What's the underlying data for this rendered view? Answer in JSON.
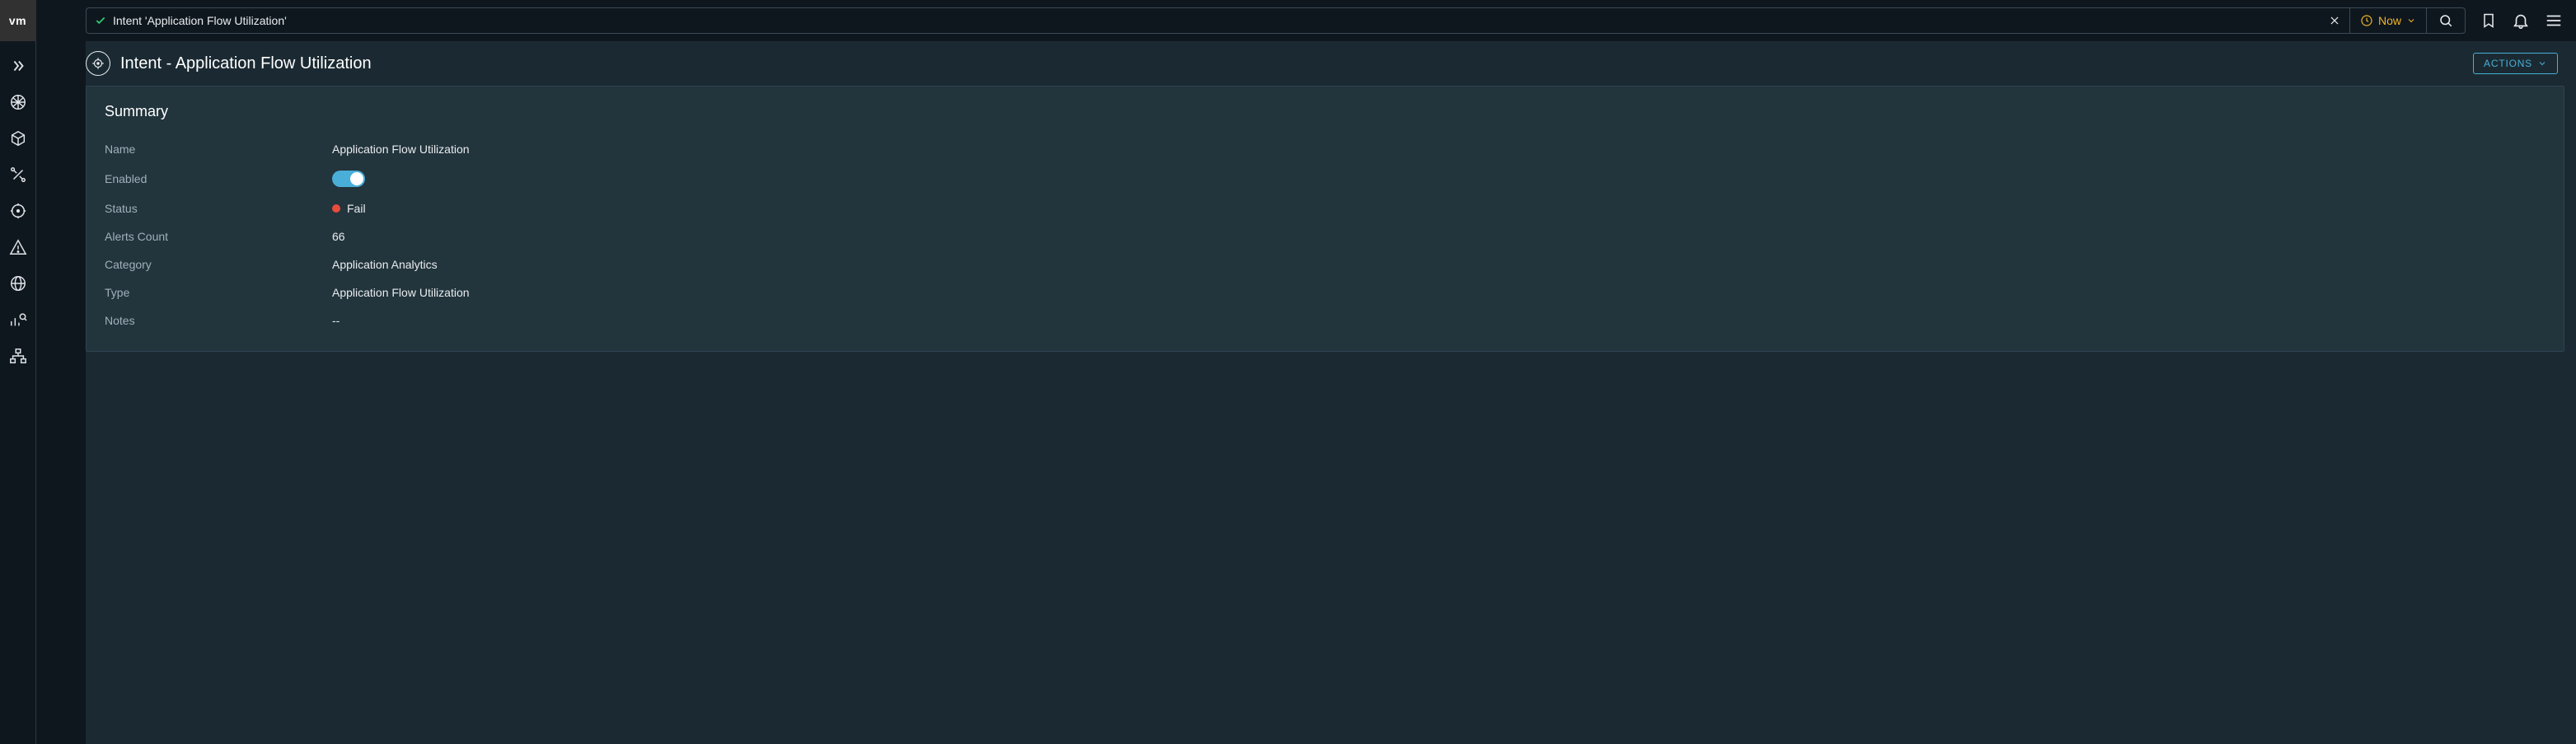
{
  "brand": "vm",
  "search": {
    "text": "Intent 'Application Flow Utilization'",
    "now_label": "Now"
  },
  "page": {
    "title": "Intent - Application Flow Utilization",
    "actions_label": "ACTIONS"
  },
  "summary": {
    "title": "Summary",
    "labels": {
      "name": "Name",
      "enabled": "Enabled",
      "status": "Status",
      "alerts_count": "Alerts Count",
      "category": "Category",
      "type": "Type",
      "notes": "Notes"
    },
    "values": {
      "name": "Application Flow Utilization",
      "enabled": true,
      "status": "Fail",
      "status_color": "#e74c3c",
      "alerts_count": "66",
      "category": "Application Analytics",
      "type": "Application Flow Utilization",
      "notes": "--"
    }
  }
}
